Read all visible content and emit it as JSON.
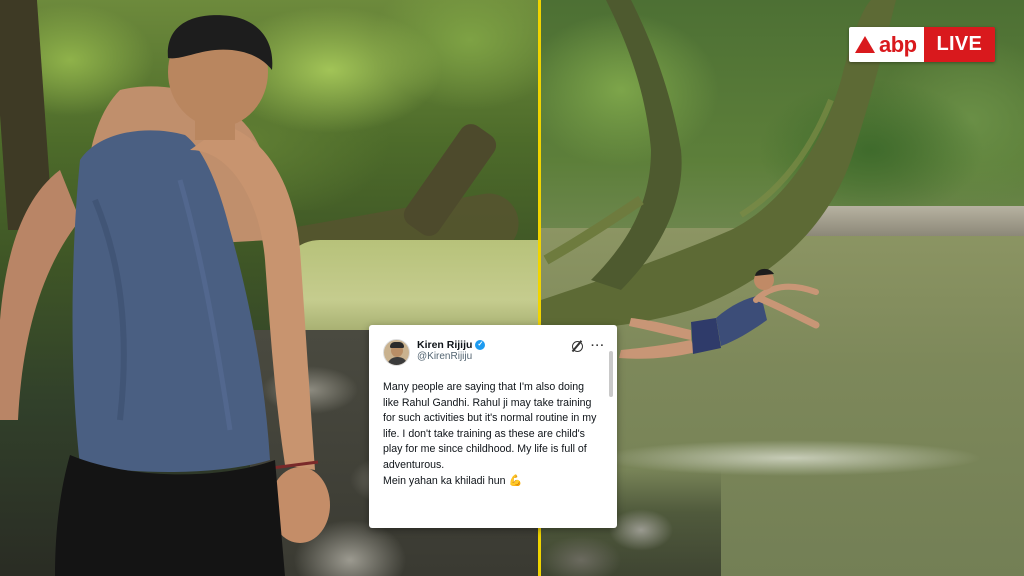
{
  "brand": {
    "logo_text": "abp",
    "live_label": "LIVE",
    "colors": {
      "brand_red": "#d9191d",
      "divider_yellow": "#f0d400"
    }
  },
  "tweet": {
    "display_name": "Kiren Rijiju",
    "handle": "@KirenRijiju",
    "verified": true,
    "icons": [
      "grok-icon",
      "more-icon"
    ],
    "more_glyph": "···",
    "verified_glyph": "✓",
    "body_lines": [
      "Many people are saying that I'm also doing like Rahul Gandhi. Rahul ji may take training for such activities but it's normal routine in my life. I don't take training as these are child's play for me since childhood. My life is full of adventurous.",
      "Mein yahan ka khiladi hun"
    ],
    "emoji": "💪"
  },
  "photos": {
    "left": "man in sleeveless vest walking on rocks by forest stream",
    "right": "man diving into river from tree branch"
  }
}
